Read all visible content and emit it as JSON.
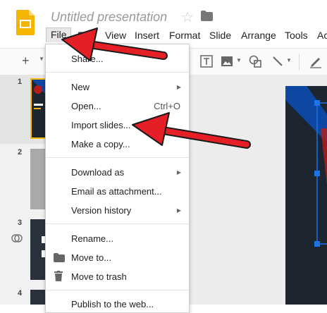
{
  "app": {
    "title": "Untitled presentation"
  },
  "menubar": [
    "File",
    "Edit",
    "View",
    "Insert",
    "Format",
    "Slide",
    "Arrange",
    "Tools",
    "Ac"
  ],
  "file_menu": {
    "share": "Share...",
    "new": "New",
    "open": "Open...",
    "open_shortcut": "Ctrl+O",
    "import_slides": "Import slides...",
    "make_copy": "Make a copy...",
    "download_as": "Download as",
    "email_attachment": "Email as attachment...",
    "version_history": "Version history",
    "rename": "Rename...",
    "move_to": "Move to...",
    "move_to_trash": "Move to trash",
    "publish": "Publish to the web..."
  },
  "filmstrip": {
    "slide_numbers": [
      "1",
      "2",
      "3",
      "4"
    ]
  },
  "toolbar": {
    "add_label": "+"
  },
  "colors": {
    "accent_red": "#e41f25",
    "slides_yellow": "#f4b400",
    "selection_blue": "#1a73e8",
    "slide_dark": "#1d2530",
    "slide_blue": "#0d47a1"
  },
  "icons": [
    "slides-logo-icon",
    "star-icon",
    "folder-icon",
    "text-box-icon",
    "image-icon",
    "shape-icon",
    "line-icon",
    "pen-icon",
    "folder-icon",
    "trash-icon",
    "link-icon"
  ]
}
